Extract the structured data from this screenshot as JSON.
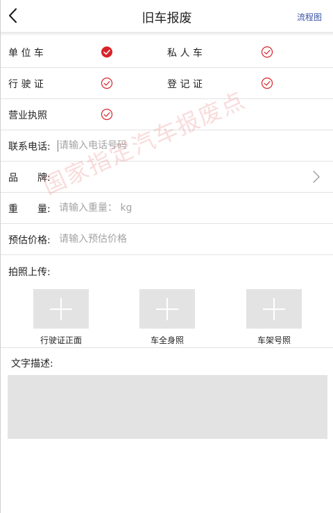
{
  "header": {
    "title": "旧车报废",
    "flow_link": "流程图"
  },
  "owner_type": {
    "company": {
      "label": "单 位 车",
      "checked": true
    },
    "private": {
      "label": "私 人 车",
      "checked": false
    }
  },
  "documents": {
    "driving_license": {
      "label": "行 驶 证",
      "checked": false
    },
    "registration": {
      "label": "登 记 证",
      "checked": false
    },
    "business_license": {
      "label": "营业执照",
      "checked": false
    }
  },
  "fields": {
    "phone": {
      "label": "联系电话:",
      "placeholder": "请输入电话号码",
      "value": ""
    },
    "brand": {
      "label": "品　　牌:",
      "value": ""
    },
    "weight": {
      "label": "重　　量:",
      "placeholder": "请输入重量： kg",
      "value": ""
    },
    "price": {
      "label": "预估价格:",
      "placeholder": "请输入预估价格",
      "value": ""
    }
  },
  "photo_upload": {
    "label": "拍照上传:",
    "items": [
      {
        "caption": "行驶证正面"
      },
      {
        "caption": "车全身照"
      },
      {
        "caption": "车架号照"
      }
    ]
  },
  "description": {
    "label": "文字描述:",
    "value": ""
  },
  "watermark": "国家指定汽车报废点",
  "colors": {
    "accent_red": "#d8232a",
    "link_blue": "#3a53a4",
    "placeholder": "#a3a3a3",
    "upload_bg": "#e3e3e3"
  },
  "icons": {
    "back": "chevron-left-icon",
    "check": "circle-check-icon",
    "chevron": "chevron-right-icon",
    "plus": "plus-icon"
  }
}
